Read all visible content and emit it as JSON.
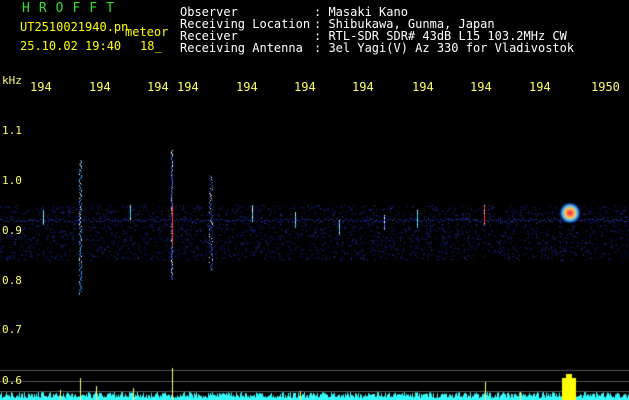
{
  "header": {
    "app_title": "HROFFT",
    "file_name": "UT2510021940.pn",
    "mode": "meteor",
    "datetime": "25.10.02 19:40",
    "minute_suffix": "18_",
    "info": [
      {
        "label": "Observer",
        "value": ": Masaki Kano"
      },
      {
        "label": "Receiving Location",
        "value": ": Shibukawa, Gunma, Japan"
      },
      {
        "label": "Receiver",
        "value": ": RTL-SDR SDR# 43dB L15 103.2MHz CW"
      },
      {
        "label": "Receiving Antenna",
        "value": ": 3el Yagi(V) Az 330 for Vladivostok"
      }
    ]
  },
  "axes": {
    "y_unit": "kHz",
    "x_ticks": [
      "194",
      "194",
      "194",
      "194",
      "194",
      "194",
      "194",
      "194",
      "194",
      "1950"
    ],
    "y_ticks": [
      "1.1",
      "1.0",
      "0.9",
      "0.8",
      "0.7",
      "0.6"
    ]
  },
  "colors": {
    "background": "#000000",
    "header_text": "#ffffff",
    "yellow_text": "#ffff00",
    "title_green": "#33dd33",
    "noise_blue": "#1a2a9a",
    "echo_cyan": "#33ccff",
    "echo_red": "#ff3333",
    "histogram": "#33ffff",
    "histogram_peak": "#ffff00"
  }
}
